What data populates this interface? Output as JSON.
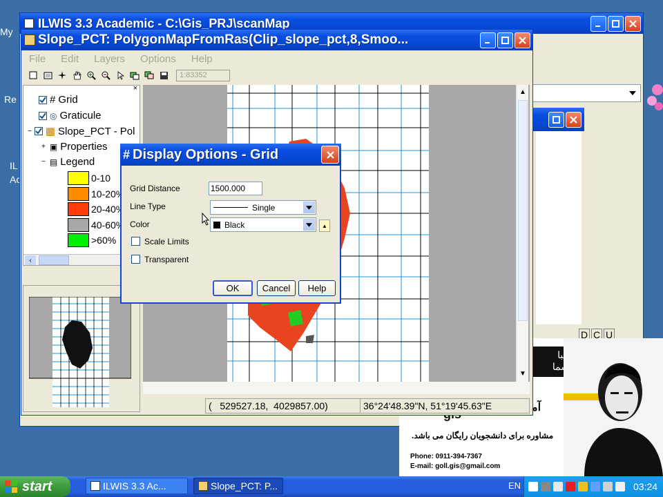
{
  "desktop": {
    "icon_labels": [
      "My",
      "Re",
      "IL",
      "Ac"
    ]
  },
  "ilwis_main": {
    "title": "ILWIS 3.3 Academic - C:\\Gis_PRJ\\scanMap"
  },
  "map_window": {
    "title": "Slope_PCT: PolygonMapFromRas(Clip_slope_pct,8,Smoo...",
    "menu": [
      "File",
      "Edit",
      "Layers",
      "Options",
      "Help"
    ],
    "scale": "1:83352",
    "status_coords": "(   529527.18,  4029857.00)",
    "status_latlon": "36°24'48.39\"N, 51°19'45.63\"E"
  },
  "layer_tree": {
    "items": [
      {
        "label": "Grid",
        "glyph": "#"
      },
      {
        "label": "Graticule",
        "glyph": "◎"
      },
      {
        "label": "Slope_PCT - Pol",
        "glyph": "▦"
      },
      {
        "label": "Properties",
        "glyph": "▣"
      },
      {
        "label": "Legend",
        "glyph": "▤"
      }
    ],
    "legend": [
      {
        "label": "0-10",
        "color": "#ffff00"
      },
      {
        "label": "10-20%",
        "color": "#ff8c00"
      },
      {
        "label": "20-40%",
        "color": "#ff3c0a"
      },
      {
        "label": "40-60%",
        "color": "#a8a8a8"
      },
      {
        "label": ">60%",
        "color": "#00ee00"
      }
    ]
  },
  "dialog": {
    "title": "Display Options - Grid",
    "grid_distance_label": "Grid Distance",
    "grid_distance_value": "1500.000",
    "line_type_label": "Line Type",
    "line_type_value": "Single",
    "color_label": "Color",
    "color_value": "Black",
    "scale_limits_label": "Scale Limits",
    "transparent_label": "Transparent",
    "ok": "OK",
    "cancel": "Cancel",
    "help": "Help"
  },
  "right_panel": {
    "dcu": [
      "D",
      "C",
      "U"
    ]
  },
  "ad": {
    "persian_line1": "آموز",
    "persian_line2": "عبا",
    "persian_line3": "شما",
    "persian_main": "مشاوره برای دانشجویان رایگان می باشد.",
    "logo": "gis",
    "phone": "Phone: 0911-394-7367",
    "email": "E-mail: goll.gis@gmail.com"
  },
  "taskbar": {
    "start": "start",
    "tasks": [
      "ILWIS 3.3 Ac...",
      "Slope_PCT: P..."
    ],
    "lang": "EN",
    "clock": "03:24"
  },
  "colors": {
    "xp_blue": "#0548d6",
    "desktop": "#3a6ea5",
    "start_green": "#3c9c3c",
    "grid_blue": "#1e90d8"
  }
}
